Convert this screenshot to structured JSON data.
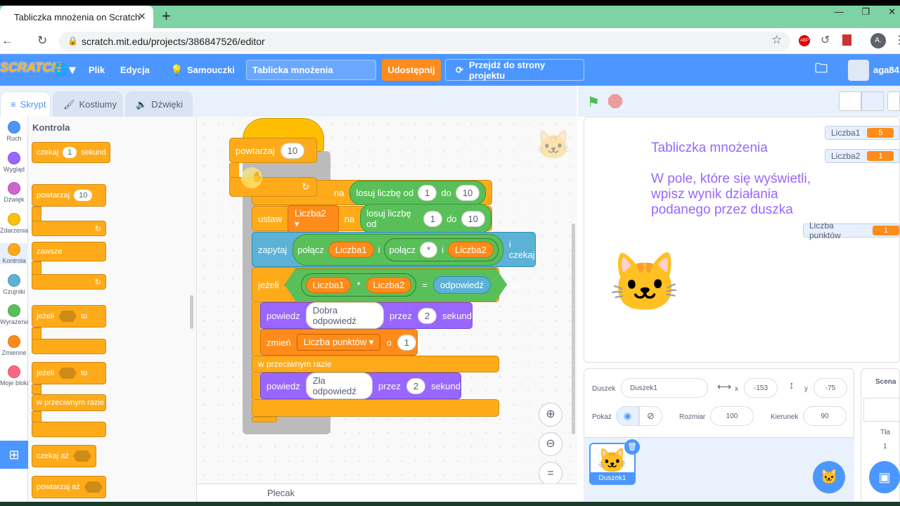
{
  "browser": {
    "tab_title": "Tabliczka mnożenia on Scratch",
    "url": "scratch.mit.edu/projects/386847526/editor",
    "profile_initial": "A."
  },
  "menu": {
    "logo": "SCRATCH",
    "file": "Plik",
    "edit": "Edycja",
    "tutorials": "Samouczki",
    "project_title": "Tablicka mnożenia",
    "share": "Udostępnij",
    "see_project": "Przejdź do strony projektu",
    "user": "aga84"
  },
  "tabs": {
    "code": "Skrypt",
    "costumes": "Kostiumy",
    "sounds": "Dźwięki"
  },
  "categories": [
    {
      "label": "Ruch",
      "color": "#4c97ff"
    },
    {
      "label": "Wygląd",
      "color": "#9966ff"
    },
    {
      "label": "Dźwięk",
      "color": "#cf63cf"
    },
    {
      "label": "Zdarzenia",
      "color": "#ffbf00"
    },
    {
      "label": "Kontrola",
      "color": "#ffab19"
    },
    {
      "label": "Czujniki",
      "color": "#5cb1d6"
    },
    {
      "label": "Wyrażenia",
      "color": "#59c059"
    },
    {
      "label": "Zmienne",
      "color": "#ff8c1a"
    },
    {
      "label": "Moje bloki",
      "color": "#ff6680"
    }
  ],
  "palette": {
    "heading": "Kontrola",
    "wait": "czekaj",
    "wait_val": "1",
    "wait_unit": "sekund",
    "repeat": "powtarzaj",
    "repeat_val": "10",
    "forever": "zawsze",
    "if": "jeżeli",
    "then": "to",
    "if2": "jeżeli",
    "then2": "to",
    "else": "w przeciwnym razie",
    "wait_until": "czekaj aż",
    "repeat_until": "powtarzaj aż"
  },
  "script": {
    "drag_repeat": "powtarzaj",
    "drag_repeat_val": "10",
    "na": "na",
    "rand1": "losuj liczbę od",
    "rand1_a": "1",
    "rand1_do": "do",
    "rand1_b": "10",
    "set2": "ustaw",
    "set2_var": "Liczba2",
    "rand2": "losuj liczbę od",
    "rand2_a": "1",
    "rand2_do": "do",
    "rand2_b": "10",
    "ask": "zapytaj",
    "join1": "połącz",
    "join_var1": "Liczba1",
    "and1": "i",
    "join2": "połącz",
    "star": "*",
    "and2": "i",
    "join_var2": "Liczba2",
    "ask_wait": "i czekaj",
    "if": "jeżeli",
    "if_v1": "Liczba1",
    "times": "*",
    "if_v2": "Liczba2",
    "eq": "=",
    "answer": "odpowiedź",
    "then": "to",
    "say1": "powiedz",
    "say1_text": "Dobra odpowiedź",
    "say1_for": "przez",
    "say1_n": "2",
    "say1_unit": "sekund",
    "change": "zmień",
    "change_var": "Liczba punktów",
    "change_by": "o",
    "change_n": "1",
    "else": "w przeciwnym razie",
    "say2": "powiedz",
    "say2_text": "Zła odpowiedź",
    "say2_for": "przez",
    "say2_n": "2",
    "say2_unit": "sekund",
    "backpack": "Plecak"
  },
  "stage": {
    "title": "Tabliczka mnożenia",
    "instructions": [
      "W pole, które się wyświetli,",
      "wpisz wynik działania",
      "podanego przez duszka"
    ],
    "monitors": [
      {
        "label": "Liczba1",
        "value": "5"
      },
      {
        "label": "Liczba2",
        "value": "1"
      },
      {
        "label": "Liczba punktów",
        "value": "1"
      }
    ]
  },
  "sprite_info": {
    "sprite_label": "Duszek",
    "sprite_name": "Duszek1",
    "x_label": "x",
    "x": "-153",
    "y_label": "y",
    "y": "-75",
    "show_label": "Pokaż",
    "size_label": "Rozmiar",
    "size": "100",
    "dir_label": "Kierunek",
    "direction": "90",
    "thumb_name": "Duszek1"
  },
  "stage_pane": {
    "title": "Scena",
    "backdrops_label": "Tła",
    "backdrops": "1"
  },
  "colors": {
    "scratch_blue": "#4c97ff",
    "control": "#ffab19",
    "variables": "#ff8c1a",
    "looks": "#9966ff",
    "operators": "#59c059",
    "sensing": "#5cb1d6"
  }
}
